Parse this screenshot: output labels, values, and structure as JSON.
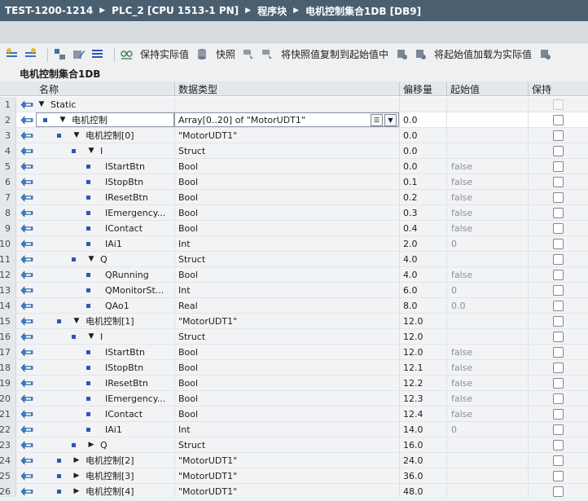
{
  "title": {
    "crumbs": [
      "TEST-1200-1214",
      "PLC_2 [CPU 1513-1 PN]",
      "程序块",
      "电机控制集合1DB [DB9]"
    ]
  },
  "toolbar": {
    "keep_actual_label": "保持实际值",
    "snapshot_label": "快照",
    "copy_snapshot_label": "将快照值复制到起始值中",
    "load_start_label": "将起始值加载为实际值"
  },
  "block_name": "电机控制集合1DB",
  "columns": {
    "name": "名称",
    "type": "数据类型",
    "offset": "偏移量",
    "start": "起始值",
    "retain": "保持"
  },
  "colors": {
    "title_bg": "#4a5f70",
    "toolbar_bg": "#eef0f2",
    "header_bg": "#e4e8ec",
    "row_bg": "#f2f3f5",
    "bullet": "#2f56b5"
  },
  "rows": [
    {
      "num": "1",
      "level": 0,
      "tri": "down",
      "bullet": false,
      "name": "Static",
      "type": "",
      "offset": "",
      "start": "",
      "retain": "disabled"
    },
    {
      "num": "2",
      "level": 1,
      "tri": "down",
      "bullet": true,
      "name": "电机控制",
      "type": "Array[0..20] of \"MotorUDT1\"",
      "offset": "0.0",
      "start": "",
      "retain": "box",
      "selected": true
    },
    {
      "num": "3",
      "level": 2,
      "tri": "down",
      "bullet": true,
      "name": "电机控制[0]",
      "type": "\"MotorUDT1\"",
      "offset": "0.0",
      "start": "",
      "retain": "box"
    },
    {
      "num": "4",
      "level": 3,
      "tri": "down",
      "bullet": true,
      "name": "I",
      "type": "Struct",
      "offset": "0.0",
      "start": "",
      "retain": "box"
    },
    {
      "num": "5",
      "level": 4,
      "tri": "",
      "bullet": true,
      "name": "IStartBtn",
      "type": "Bool",
      "offset": "0.0",
      "start": "false",
      "retain": "box"
    },
    {
      "num": "6",
      "level": 4,
      "tri": "",
      "bullet": true,
      "name": "IStopBtn",
      "type": "Bool",
      "offset": "0.1",
      "start": "false",
      "retain": "box"
    },
    {
      "num": "7",
      "level": 4,
      "tri": "",
      "bullet": true,
      "name": "IResetBtn",
      "type": "Bool",
      "offset": "0.2",
      "start": "false",
      "retain": "box"
    },
    {
      "num": "8",
      "level": 4,
      "tri": "",
      "bullet": true,
      "name": "IEmergency...",
      "type": "Bool",
      "offset": "0.3",
      "start": "false",
      "retain": "box"
    },
    {
      "num": "9",
      "level": 4,
      "tri": "",
      "bullet": true,
      "name": "IContact",
      "type": "Bool",
      "offset": "0.4",
      "start": "false",
      "retain": "box"
    },
    {
      "num": "10",
      "level": 4,
      "tri": "",
      "bullet": true,
      "name": "IAi1",
      "type": "Int",
      "offset": "2.0",
      "start": "0",
      "retain": "box"
    },
    {
      "num": "11",
      "level": 3,
      "tri": "down",
      "bullet": true,
      "name": "Q",
      "type": "Struct",
      "offset": "4.0",
      "start": "",
      "retain": "box"
    },
    {
      "num": "12",
      "level": 4,
      "tri": "",
      "bullet": true,
      "name": "QRunning",
      "type": "Bool",
      "offset": "4.0",
      "start": "false",
      "retain": "box"
    },
    {
      "num": "13",
      "level": 4,
      "tri": "",
      "bullet": true,
      "name": "QMonitorSt...",
      "type": "Int",
      "offset": "6.0",
      "start": "0",
      "retain": "box"
    },
    {
      "num": "14",
      "level": 4,
      "tri": "",
      "bullet": true,
      "name": "QAo1",
      "type": "Real",
      "offset": "8.0",
      "start": "0.0",
      "retain": "box"
    },
    {
      "num": "15",
      "level": 2,
      "tri": "down",
      "bullet": true,
      "name": "电机控制[1]",
      "type": "\"MotorUDT1\"",
      "offset": "12.0",
      "start": "",
      "retain": "box"
    },
    {
      "num": "16",
      "level": 3,
      "tri": "down",
      "bullet": true,
      "name": "I",
      "type": "Struct",
      "offset": "12.0",
      "start": "",
      "retain": "box"
    },
    {
      "num": "17",
      "level": 4,
      "tri": "",
      "bullet": true,
      "name": "IStartBtn",
      "type": "Bool",
      "offset": "12.0",
      "start": "false",
      "retain": "box"
    },
    {
      "num": "18",
      "level": 4,
      "tri": "",
      "bullet": true,
      "name": "IStopBtn",
      "type": "Bool",
      "offset": "12.1",
      "start": "false",
      "retain": "box"
    },
    {
      "num": "19",
      "level": 4,
      "tri": "",
      "bullet": true,
      "name": "IResetBtn",
      "type": "Bool",
      "offset": "12.2",
      "start": "false",
      "retain": "box"
    },
    {
      "num": "20",
      "level": 4,
      "tri": "",
      "bullet": true,
      "name": "IEmergency...",
      "type": "Bool",
      "offset": "12.3",
      "start": "false",
      "retain": "box"
    },
    {
      "num": "21",
      "level": 4,
      "tri": "",
      "bullet": true,
      "name": "IContact",
      "type": "Bool",
      "offset": "12.4",
      "start": "false",
      "retain": "box"
    },
    {
      "num": "22",
      "level": 4,
      "tri": "",
      "bullet": true,
      "name": "IAi1",
      "type": "Int",
      "offset": "14.0",
      "start": "0",
      "retain": "box"
    },
    {
      "num": "23",
      "level": 3,
      "tri": "right",
      "bullet": true,
      "name": "Q",
      "type": "Struct",
      "offset": "16.0",
      "start": "",
      "retain": "box"
    },
    {
      "num": "24",
      "level": 2,
      "tri": "right",
      "bullet": true,
      "name": "电机控制[2]",
      "type": "\"MotorUDT1\"",
      "offset": "24.0",
      "start": "",
      "retain": "box"
    },
    {
      "num": "25",
      "level": 2,
      "tri": "right",
      "bullet": true,
      "name": "电机控制[3]",
      "type": "\"MotorUDT1\"",
      "offset": "36.0",
      "start": "",
      "retain": "box"
    },
    {
      "num": "26",
      "level": 2,
      "tri": "right",
      "bullet": true,
      "name": "电机控制[4]",
      "type": "\"MotorUDT1\"",
      "offset": "48.0",
      "start": "",
      "retain": "box"
    }
  ]
}
